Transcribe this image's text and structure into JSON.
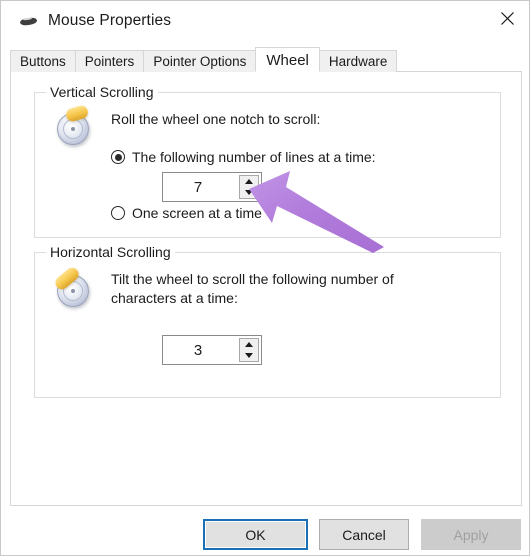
{
  "window": {
    "title": "Mouse Properties",
    "icon": "mouse-icon",
    "close_label": "✕"
  },
  "tabs": [
    {
      "label": "Buttons",
      "active": false
    },
    {
      "label": "Pointers",
      "active": false
    },
    {
      "label": "Pointer Options",
      "active": false
    },
    {
      "label": "Wheel",
      "active": true
    },
    {
      "label": "Hardware",
      "active": false
    }
  ],
  "vertical_scrolling": {
    "group_title": "Vertical Scrolling",
    "icon": "vertical-scroll-wheel-icon",
    "description": "Roll the wheel one notch to scroll:",
    "option_lines": {
      "label": "The following number of lines at a time:",
      "selected": true
    },
    "option_screen": {
      "label": "One screen at a time",
      "selected": false
    },
    "spinner_value": "7",
    "spin_up_icon": "triangle-up-icon",
    "spin_down_icon": "triangle-down-icon"
  },
  "horizontal_scrolling": {
    "group_title": "Horizontal Scrolling",
    "icon": "horizontal-scroll-wheel-icon",
    "description": "Tilt the wheel to scroll the following number of characters at a time:",
    "spinner_value": "3",
    "spin_up_icon": "triangle-up-icon",
    "spin_down_icon": "triangle-down-icon"
  },
  "footer": {
    "ok_label": "OK",
    "cancel_label": "Cancel",
    "apply_label": "Apply",
    "apply_disabled": true
  },
  "annotation": {
    "type": "arrow",
    "direction": "up-left",
    "target": "vertical-scrolling-spinner",
    "color": "#b17cdb"
  },
  "colors": {
    "accent_focus": "#1a6fb5",
    "dialog_background": "#ffffff",
    "button_face": "#e1e1e1",
    "annotation_purple": "#b17cdb"
  }
}
